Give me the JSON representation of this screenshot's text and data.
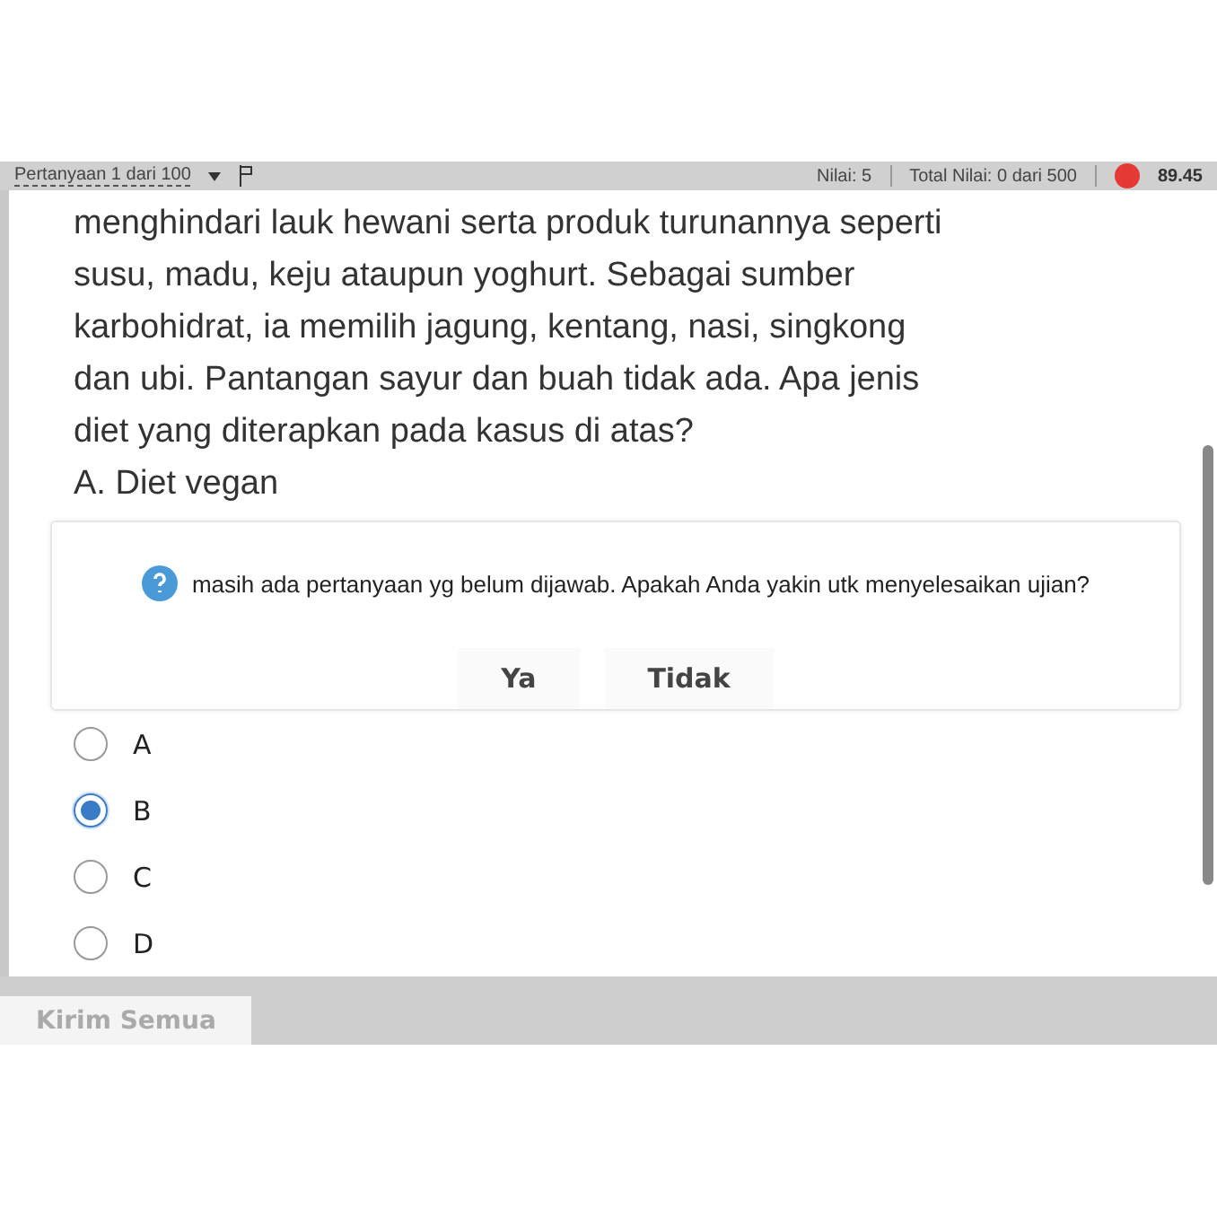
{
  "header": {
    "question_selector": "Pertanyaan 1 dari 100",
    "score": "Nilai: 5",
    "total_score": "Total Nilai: 0 dari 500",
    "timer": "89.45"
  },
  "question": {
    "lines": [
      "menghindari lauk hewani serta produk turunannya seperti",
      "susu, madu, keju ataupun yoghurt.  Sebagai sumber",
      "karbohidrat, ia memilih jagung, kentang, nasi, singkong",
      "dan ubi. Pantangan sayur dan buah tidak ada. Apa jenis",
      "diet yang diterapkan pada kasus di atas?",
      "A. Diet vegan"
    ]
  },
  "dialog": {
    "message": "masih ada pertanyaan yg belum dijawab. Apakah Anda yakin utk menyelesaikan ujian?",
    "buttons": [
      "Ya",
      "Tidak"
    ]
  },
  "options": [
    {
      "label": "A",
      "selected": false
    },
    {
      "label": "B",
      "selected": true
    },
    {
      "label": "C",
      "selected": false
    },
    {
      "label": "D",
      "selected": false
    }
  ],
  "footer": {
    "tab": "Kirim Semua"
  }
}
